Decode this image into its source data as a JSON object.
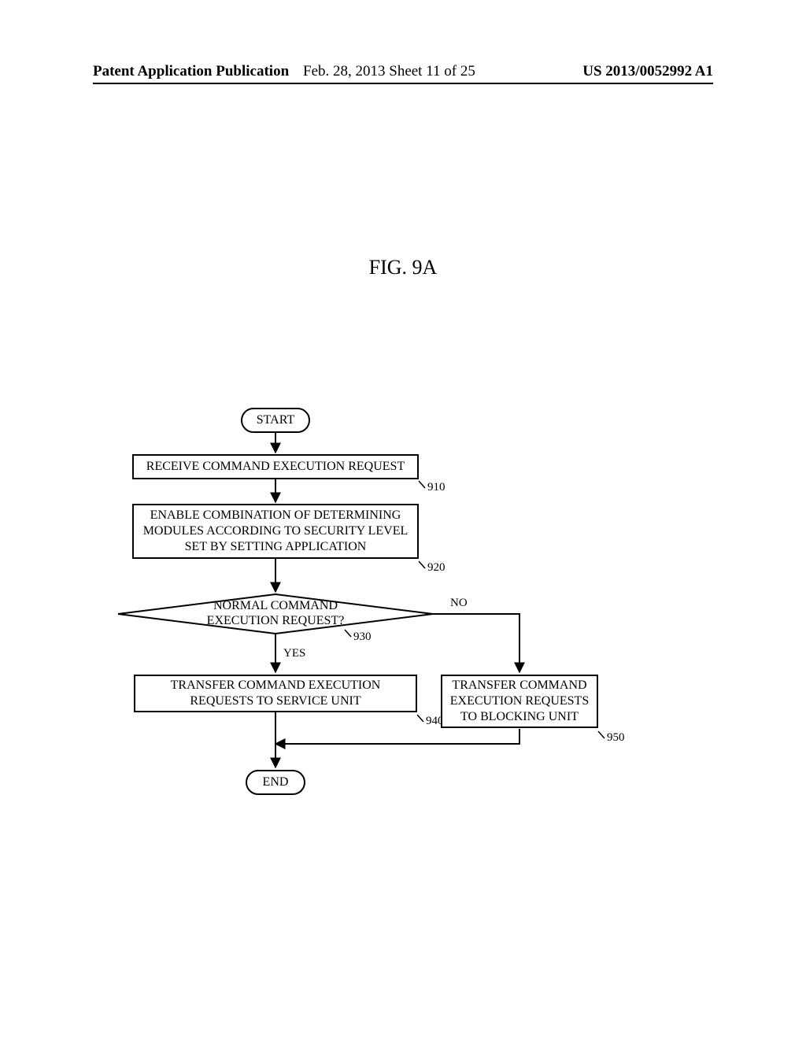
{
  "header": {
    "left": "Patent Application Publication",
    "center": "Feb. 28, 2013  Sheet 11 of 25",
    "right": "US 2013/0052992 A1"
  },
  "figure_title": "FIG. 9A",
  "chart_data": {
    "type": "flowchart",
    "nodes": [
      {
        "id": "start",
        "kind": "terminator",
        "text": "START"
      },
      {
        "id": "n910",
        "kind": "process",
        "ref": "910",
        "text": "RECEIVE COMMAND EXECUTION REQUEST"
      },
      {
        "id": "n920",
        "kind": "process",
        "ref": "920",
        "text": "ENABLE COMBINATION OF DETERMINING MODULES ACCORDING TO SECURITY LEVEL SET BY SETTING APPLICATION"
      },
      {
        "id": "n930",
        "kind": "decision",
        "ref": "930",
        "text": "NORMAL COMMAND EXECUTION REQUEST?"
      },
      {
        "id": "n940",
        "kind": "process",
        "ref": "940",
        "text": "TRANSFER COMMAND EXECUTION REQUESTS TO SERVICE UNIT"
      },
      {
        "id": "n950",
        "kind": "process",
        "ref": "950",
        "text": "TRANSFER COMMAND EXECUTION REQUESTS TO BLOCKING UNIT"
      },
      {
        "id": "end",
        "kind": "terminator",
        "text": "END"
      }
    ],
    "edges": [
      {
        "from": "start",
        "to": "n910"
      },
      {
        "from": "n910",
        "to": "n920"
      },
      {
        "from": "n920",
        "to": "n930"
      },
      {
        "from": "n930",
        "to": "n940",
        "label": "YES"
      },
      {
        "from": "n930",
        "to": "n950",
        "label": "NO"
      },
      {
        "from": "n940",
        "to": "end"
      },
      {
        "from": "n950",
        "to": "end"
      }
    ]
  },
  "nodes": {
    "start": "START",
    "n910": "RECEIVE COMMAND EXECUTION REQUEST",
    "n920": "ENABLE COMBINATION OF DETERMINING MODULES ACCORDING TO SECURITY LEVEL SET BY SETTING APPLICATION",
    "n930": "NORMAL COMMAND EXECUTION REQUEST?",
    "n940": "TRANSFER COMMAND EXECUTION REQUESTS TO SERVICE UNIT",
    "n950": "TRANSFER COMMAND EXECUTION REQUESTS TO BLOCKING UNIT",
    "end": "END"
  },
  "refs": {
    "n910": "910",
    "n920": "920",
    "n930": "930",
    "n940": "940",
    "n950": "950"
  },
  "edge_labels": {
    "yes": "YES",
    "no": "NO"
  }
}
